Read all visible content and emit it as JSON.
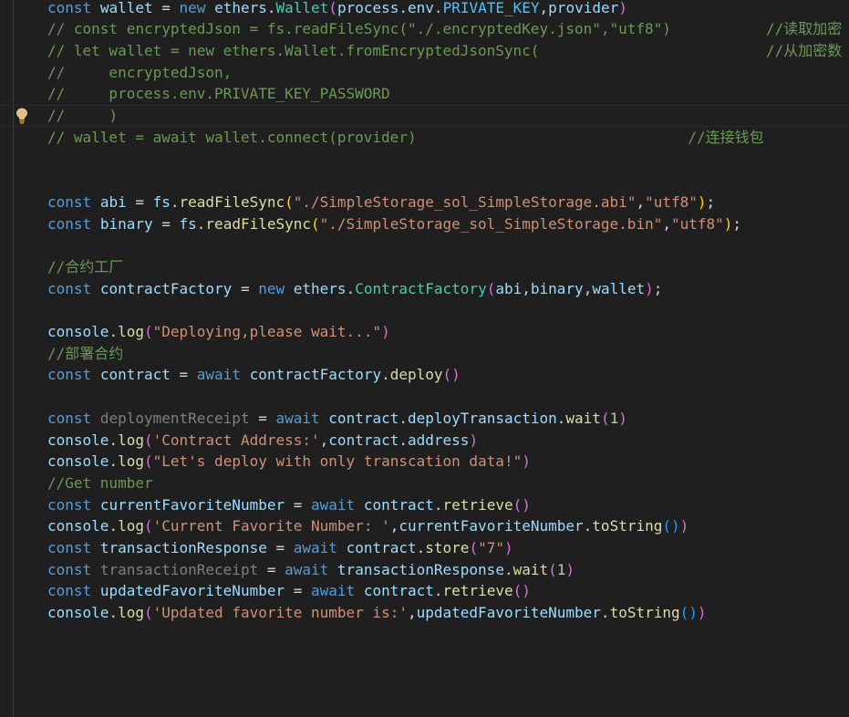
{
  "editor": {
    "language": "javascript",
    "theme": "dark",
    "gutter_icon": "lightbulb-icon",
    "colors": {
      "background": "#1f1f1f",
      "keyword": "#569cd6",
      "variable": "#9cdcfe",
      "function": "#dcdcaa",
      "class": "#4ec9b0",
      "string": "#ce9178",
      "number": "#b5cea8",
      "constant": "#4fc1ff",
      "comment": "#6a9955",
      "bracket1": "#ffd700",
      "bracket2": "#da70d6",
      "bracket3": "#179fff"
    },
    "lines": [
      {
        "tokens": [
          {
            "t": "const",
            "c": "kw"
          },
          {
            "t": " ",
            "c": "pl"
          },
          {
            "t": "wallet",
            "c": "var"
          },
          {
            "t": " = ",
            "c": "pl"
          },
          {
            "t": "new",
            "c": "kw"
          },
          {
            "t": " ",
            "c": "pl"
          },
          {
            "t": "ethers",
            "c": "var"
          },
          {
            "t": ".",
            "c": "pl"
          },
          {
            "t": "Wallet",
            "c": "cls"
          },
          {
            "t": "(",
            "c": "b2"
          },
          {
            "t": "process",
            "c": "var"
          },
          {
            "t": ".",
            "c": "pl"
          },
          {
            "t": "env",
            "c": "var"
          },
          {
            "t": ".",
            "c": "pl"
          },
          {
            "t": "PRIVATE_KEY",
            "c": "con"
          },
          {
            "t": ",",
            "c": "pl"
          },
          {
            "t": "provider",
            "c": "var"
          },
          {
            "t": ")",
            "c": "b2"
          }
        ]
      },
      {
        "tokens": [
          {
            "t": "// const encryptedJson = fs.readFileSync(\"./.encryptedKey.json\",\"utf8\")",
            "c": "cmt"
          }
        ],
        "trail": "//读取加密"
      },
      {
        "tokens": [
          {
            "t": "// let wallet = new ethers.Wallet.fromEncryptedJsonSync(",
            "c": "cmt"
          }
        ],
        "trail": "//从加密数"
      },
      {
        "tokens": [
          {
            "t": "//     encryptedJson,",
            "c": "cmt"
          }
        ]
      },
      {
        "tokens": [
          {
            "t": "//     process.env.PRIVATE_KEY_PASSWORD",
            "c": "cmt"
          }
        ]
      },
      {
        "current": true,
        "tokens": [
          {
            "t": "//     )",
            "c": "cmt"
          }
        ]
      },
      {
        "tokens": [
          {
            "t": "// wallet = await wallet.connect(provider)",
            "c": "cmt"
          }
        ],
        "trail": "//连接钱包",
        "trail_col": 49
      },
      {
        "tokens": []
      },
      {
        "tokens": []
      },
      {
        "tokens": [
          {
            "t": "const",
            "c": "kw"
          },
          {
            "t": " ",
            "c": "pl"
          },
          {
            "t": "abi",
            "c": "var"
          },
          {
            "t": " = ",
            "c": "pl"
          },
          {
            "t": "fs",
            "c": "var"
          },
          {
            "t": ".",
            "c": "pl"
          },
          {
            "t": "readFileSync",
            "c": "fn"
          },
          {
            "t": "(",
            "c": "b1"
          },
          {
            "t": "\"./SimpleStorage_sol_SimpleStorage.abi\"",
            "c": "str"
          },
          {
            "t": ",",
            "c": "pl"
          },
          {
            "t": "\"utf8\"",
            "c": "str"
          },
          {
            "t": ")",
            "c": "b1"
          },
          {
            "t": ";",
            "c": "pl"
          }
        ]
      },
      {
        "tokens": [
          {
            "t": "const",
            "c": "kw"
          },
          {
            "t": " ",
            "c": "pl"
          },
          {
            "t": "binary",
            "c": "var"
          },
          {
            "t": " = ",
            "c": "pl"
          },
          {
            "t": "fs",
            "c": "var"
          },
          {
            "t": ".",
            "c": "pl"
          },
          {
            "t": "readFileSync",
            "c": "fn"
          },
          {
            "t": "(",
            "c": "b1"
          },
          {
            "t": "\"./SimpleStorage_sol_SimpleStorage.bin\"",
            "c": "str"
          },
          {
            "t": ",",
            "c": "pl"
          },
          {
            "t": "\"utf8\"",
            "c": "str"
          },
          {
            "t": ")",
            "c": "b1"
          },
          {
            "t": ";",
            "c": "pl"
          }
        ]
      },
      {
        "tokens": []
      },
      {
        "tokens": [
          {
            "t": "//合约工厂",
            "c": "cmt"
          }
        ]
      },
      {
        "tokens": [
          {
            "t": "const",
            "c": "kw"
          },
          {
            "t": " ",
            "c": "pl"
          },
          {
            "t": "contractFactory",
            "c": "var"
          },
          {
            "t": " = ",
            "c": "pl"
          },
          {
            "t": "new",
            "c": "kw"
          },
          {
            "t": " ",
            "c": "pl"
          },
          {
            "t": "ethers",
            "c": "var"
          },
          {
            "t": ".",
            "c": "pl"
          },
          {
            "t": "ContractFactory",
            "c": "cls"
          },
          {
            "t": "(",
            "c": "b2"
          },
          {
            "t": "abi",
            "c": "var"
          },
          {
            "t": ",",
            "c": "pl"
          },
          {
            "t": "binary",
            "c": "var"
          },
          {
            "t": ",",
            "c": "pl"
          },
          {
            "t": "wallet",
            "c": "var"
          },
          {
            "t": ")",
            "c": "b2"
          },
          {
            "t": ";",
            "c": "pl"
          }
        ]
      },
      {
        "tokens": []
      },
      {
        "tokens": [
          {
            "t": "console",
            "c": "var"
          },
          {
            "t": ".",
            "c": "pl"
          },
          {
            "t": "log",
            "c": "fn"
          },
          {
            "t": "(",
            "c": "b2"
          },
          {
            "t": "\"Deploying,please wait...\"",
            "c": "str"
          },
          {
            "t": ")",
            "c": "b2"
          }
        ]
      },
      {
        "tokens": [
          {
            "t": "//部署合约",
            "c": "cmt"
          }
        ]
      },
      {
        "tokens": [
          {
            "t": "const",
            "c": "kw"
          },
          {
            "t": " ",
            "c": "pl"
          },
          {
            "t": "contract",
            "c": "var"
          },
          {
            "t": " = ",
            "c": "pl"
          },
          {
            "t": "await",
            "c": "kw"
          },
          {
            "t": " ",
            "c": "pl"
          },
          {
            "t": "contractFactory",
            "c": "var"
          },
          {
            "t": ".",
            "c": "pl"
          },
          {
            "t": "deploy",
            "c": "fn"
          },
          {
            "t": "()",
            "c": "b2"
          }
        ]
      },
      {
        "tokens": []
      },
      {
        "tokens": [
          {
            "t": "const",
            "c": "kw"
          },
          {
            "t": " ",
            "c": "pl"
          },
          {
            "t": "deploymentReceipt",
            "c": "muted"
          },
          {
            "t": " = ",
            "c": "pl"
          },
          {
            "t": "await",
            "c": "kw"
          },
          {
            "t": " ",
            "c": "pl"
          },
          {
            "t": "contract",
            "c": "var"
          },
          {
            "t": ".",
            "c": "pl"
          },
          {
            "t": "deployTransaction",
            "c": "var"
          },
          {
            "t": ".",
            "c": "pl"
          },
          {
            "t": "wait",
            "c": "fn"
          },
          {
            "t": "(",
            "c": "b2"
          },
          {
            "t": "1",
            "c": "num"
          },
          {
            "t": ")",
            "c": "b2"
          }
        ]
      },
      {
        "tokens": [
          {
            "t": "console",
            "c": "var"
          },
          {
            "t": ".",
            "c": "pl"
          },
          {
            "t": "log",
            "c": "fn"
          },
          {
            "t": "(",
            "c": "b2"
          },
          {
            "t": "'Contract Address:'",
            "c": "str"
          },
          {
            "t": ",",
            "c": "pl"
          },
          {
            "t": "contract",
            "c": "var"
          },
          {
            "t": ".",
            "c": "pl"
          },
          {
            "t": "address",
            "c": "var"
          },
          {
            "t": ")",
            "c": "b2"
          }
        ]
      },
      {
        "tokens": [
          {
            "t": "console",
            "c": "var"
          },
          {
            "t": ".",
            "c": "pl"
          },
          {
            "t": "log",
            "c": "fn"
          },
          {
            "t": "(",
            "c": "b2"
          },
          {
            "t": "\"Let's deploy with only transcation data!\"",
            "c": "str"
          },
          {
            "t": ")",
            "c": "b2"
          }
        ]
      },
      {
        "tokens": [
          {
            "t": "//Get number",
            "c": "cmt"
          }
        ]
      },
      {
        "tokens": [
          {
            "t": "const",
            "c": "kw"
          },
          {
            "t": " ",
            "c": "pl"
          },
          {
            "t": "currentFavoriteNumber",
            "c": "var"
          },
          {
            "t": " = ",
            "c": "pl"
          },
          {
            "t": "await",
            "c": "kw"
          },
          {
            "t": " ",
            "c": "pl"
          },
          {
            "t": "contract",
            "c": "var"
          },
          {
            "t": ".",
            "c": "pl"
          },
          {
            "t": "retrieve",
            "c": "fn"
          },
          {
            "t": "()",
            "c": "b2"
          }
        ]
      },
      {
        "tokens": [
          {
            "t": "console",
            "c": "var"
          },
          {
            "t": ".",
            "c": "pl"
          },
          {
            "t": "log",
            "c": "fn"
          },
          {
            "t": "(",
            "c": "b2"
          },
          {
            "t": "'Current Favorite Number: '",
            "c": "str"
          },
          {
            "t": ",",
            "c": "pl"
          },
          {
            "t": "currentFavoriteNumber",
            "c": "var"
          },
          {
            "t": ".",
            "c": "pl"
          },
          {
            "t": "toString",
            "c": "fn"
          },
          {
            "t": "()",
            "c": "b3"
          },
          {
            "t": ")",
            "c": "b2"
          }
        ]
      },
      {
        "tokens": [
          {
            "t": "const",
            "c": "kw"
          },
          {
            "t": " ",
            "c": "pl"
          },
          {
            "t": "transactionResponse",
            "c": "var"
          },
          {
            "t": " = ",
            "c": "pl"
          },
          {
            "t": "await",
            "c": "kw"
          },
          {
            "t": " ",
            "c": "pl"
          },
          {
            "t": "contract",
            "c": "var"
          },
          {
            "t": ".",
            "c": "pl"
          },
          {
            "t": "store",
            "c": "fn"
          },
          {
            "t": "(",
            "c": "b2"
          },
          {
            "t": "\"7\"",
            "c": "str"
          },
          {
            "t": ")",
            "c": "b2"
          }
        ]
      },
      {
        "tokens": [
          {
            "t": "const",
            "c": "kw"
          },
          {
            "t": " ",
            "c": "pl"
          },
          {
            "t": "transactionReceipt",
            "c": "muted"
          },
          {
            "t": " = ",
            "c": "pl"
          },
          {
            "t": "await",
            "c": "kw"
          },
          {
            "t": " ",
            "c": "pl"
          },
          {
            "t": "transactionResponse",
            "c": "var"
          },
          {
            "t": ".",
            "c": "pl"
          },
          {
            "t": "wait",
            "c": "fn"
          },
          {
            "t": "(",
            "c": "b2"
          },
          {
            "t": "1",
            "c": "num"
          },
          {
            "t": ")",
            "c": "b2"
          }
        ]
      },
      {
        "tokens": [
          {
            "t": "const",
            "c": "kw"
          },
          {
            "t": " ",
            "c": "pl"
          },
          {
            "t": "updatedFavoriteNumber",
            "c": "var"
          },
          {
            "t": " = ",
            "c": "pl"
          },
          {
            "t": "await",
            "c": "kw"
          },
          {
            "t": " ",
            "c": "pl"
          },
          {
            "t": "contract",
            "c": "var"
          },
          {
            "t": ".",
            "c": "pl"
          },
          {
            "t": "retrieve",
            "c": "fn"
          },
          {
            "t": "()",
            "c": "b2"
          }
        ]
      },
      {
        "tokens": [
          {
            "t": "console",
            "c": "var"
          },
          {
            "t": ".",
            "c": "pl"
          },
          {
            "t": "log",
            "c": "fn"
          },
          {
            "t": "(",
            "c": "b2"
          },
          {
            "t": "'Updated favorite number is:'",
            "c": "str"
          },
          {
            "t": ",",
            "c": "pl"
          },
          {
            "t": "updatedFavoriteNumber",
            "c": "var"
          },
          {
            "t": ".",
            "c": "pl"
          },
          {
            "t": "toString",
            "c": "fn"
          },
          {
            "t": "()",
            "c": "b3"
          },
          {
            "t": ")",
            "c": "b2"
          }
        ]
      }
    ]
  }
}
